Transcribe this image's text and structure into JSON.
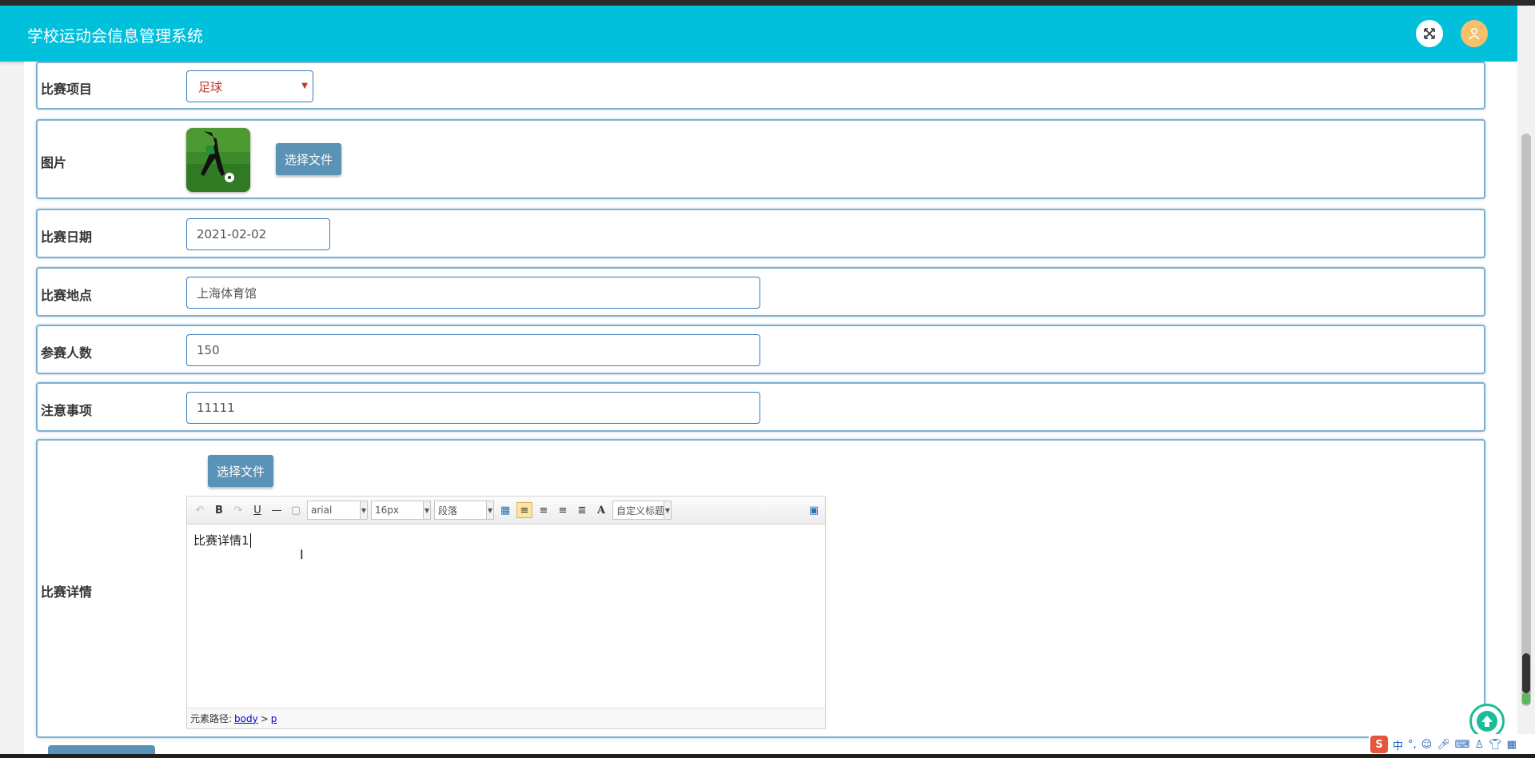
{
  "header": {
    "title": "学校运动会信息管理系统"
  },
  "form": {
    "event": {
      "label": "比赛项目",
      "value": "足球"
    },
    "image": {
      "label": "图片",
      "button": "选择文件"
    },
    "date": {
      "label": "比赛日期",
      "value": "2021-02-02"
    },
    "location": {
      "label": "比赛地点",
      "value": "上海体育馆"
    },
    "participants": {
      "label": "参赛人数",
      "value": "150"
    },
    "notes": {
      "label": "注意事项",
      "value": "11111"
    },
    "details": {
      "label": "比赛详情",
      "button": "选择文件",
      "toolbar": {
        "font": "arial",
        "size": "16px",
        "paragraph": "段落",
        "heading": "自定义标题"
      },
      "content": "比赛详情1",
      "footer": {
        "path_label": "元素路径:",
        "body": "body",
        "sep": ">",
        "p": "p"
      }
    }
  },
  "tray": {
    "ime": "中",
    "punct": "°,"
  },
  "colors": {
    "header": "#00c0dc",
    "button": "#5a93b5",
    "border": "#7fb0d0"
  }
}
